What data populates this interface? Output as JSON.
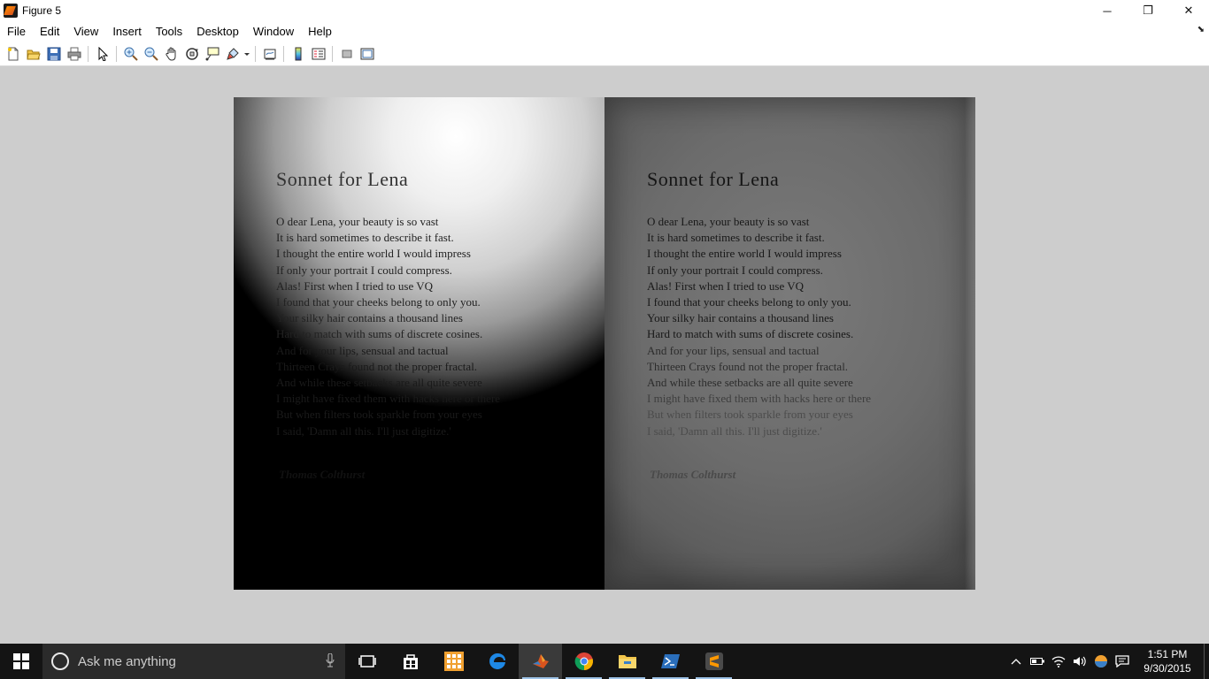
{
  "window": {
    "title": "Figure 5",
    "controls": {
      "minimize": "─",
      "restore": "❐",
      "close": "✕"
    }
  },
  "menubar": {
    "items": [
      "File",
      "Edit",
      "View",
      "Insert",
      "Tools",
      "Desktop",
      "Window",
      "Help"
    ],
    "dock_glyph": "⬊"
  },
  "toolbar": {
    "buttons": [
      "new-figure-icon",
      "open-file-icon",
      "save-icon",
      "print-icon",
      "edit-plot-arrow-icon",
      "zoom-in-icon",
      "zoom-out-icon",
      "pan-hand-icon",
      "rotate-3d-icon",
      "data-cursor-icon",
      "brush-icon",
      "link-plot-icon",
      "insert-colorbar-icon",
      "insert-legend-icon",
      "hide-plot-tools-icon",
      "show-plot-tools-icon"
    ]
  },
  "figure": {
    "left_panel": {
      "title": "Sonnet for Lena",
      "lines": [
        "O dear Lena, your beauty is so vast",
        "It is hard sometimes to describe it fast.",
        "I thought the entire world I would impress",
        "If only your portrait I could compress.",
        "Alas! First when I tried to use VQ",
        "I found that your cheeks belong to only you.",
        "Your silky hair contains a thousand lines",
        "Hard to match with sums of discrete cosines.",
        "And for your lips, sensual and tactual",
        "Thirteen Crays found not the proper fractal.",
        "And while these setbacks are all quite severe",
        "I might have fixed them with hacks here or there",
        "But when filters took sparkle from your eyes",
        "I said, 'Damn all this. I'll just digitize.'"
      ],
      "author": "Thomas Colthurst"
    },
    "right_panel": {
      "title": "Sonnet for Lena",
      "lines": [
        "O dear Lena, your beauty is so vast",
        "It is hard sometimes to describe it fast.",
        "I thought the entire world I would impress",
        "If only your portrait I could compress.",
        "Alas! First when I tried to use VQ",
        "I found that your cheeks belong to only you.",
        "Your silky hair contains a thousand lines",
        "Hard to match with sums of discrete cosines.",
        "And for your lips, sensual and tactual",
        "Thirteen Crays found not the proper fractal.",
        "And while these setbacks are all quite severe",
        "I might have fixed them with hacks here or there",
        "But when filters took sparkle from your eyes",
        "I said, 'Damn all this. I'll just digitize.'"
      ],
      "author": "Thomas Colthurst"
    }
  },
  "taskbar": {
    "search_placeholder": "Ask me anything",
    "apps": [
      "task-view-icon",
      "store-icon",
      "app-grid-icon",
      "edge-icon",
      "matlab-icon",
      "chrome-icon",
      "file-explorer-icon",
      "powershell-icon",
      "sublime-text-icon"
    ],
    "tray": {
      "time": "1:51 PM",
      "date": "9/30/2015"
    }
  },
  "colors": {
    "figure_background": "#cdcdcd",
    "taskbar": "#141414",
    "search_box": "#2b2b2b"
  }
}
